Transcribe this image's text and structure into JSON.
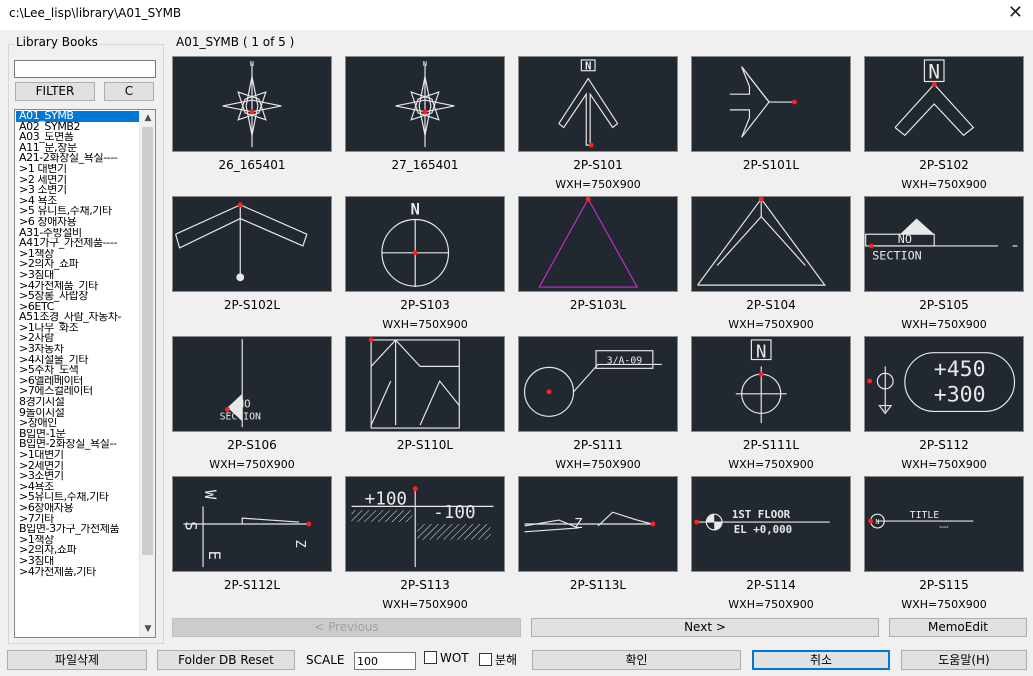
{
  "window": {
    "title": "c:\\Lee_lisp\\library\\A01_SYMB",
    "close_icon": "close-icon"
  },
  "sidebar": {
    "group_label": "Library Books",
    "filter_value": "",
    "filter_button": "FILTER",
    "clear_button": "C",
    "items": [
      "A01_SYMB",
      "A02_SYMB2",
      "A03_도면폼",
      "A11_문,창문",
      "A21-2화장실_욕실----",
      ">1 대변기",
      ">2 세면기",
      ">3 소변기",
      ">4 욕조",
      ">5 유니트,수채,기타",
      ">6 장애자용",
      "A31-주방설비",
      "A41가구_가전제품----",
      ">1책상",
      ">2의자_쇼파",
      ">3침대",
      ">4가전제품_기타",
      ">5장롱_사랍장",
      ">6ETC",
      "A51조경_사람_자동차-",
      ">1나무_화조",
      ">2사람",
      ">3자동차",
      ">4시설물_기타",
      ">5주차_도색",
      ">6엘레베이터",
      ">7에스컬레이터",
      "8경기시설",
      "9놀이시설",
      ">장애인",
      "B입면-1문",
      "B입면-2화장실_욕실--",
      ">1대변기",
      ">2세면기",
      ">3소변기",
      ">4욕조",
      ">5유니트,수채,기타",
      ">6장애자용",
      ">7기타",
      "B입면-3가구_가전제품",
      ">1책상",
      ">2의자,쇼파",
      ">3침대",
      ">4가전제품,기타"
    ]
  },
  "pager": {
    "label": "A01_SYMB ( 1 of 5 )"
  },
  "tiles": [
    {
      "name": "26_165401",
      "size": ""
    },
    {
      "name": "27_165401",
      "size": ""
    },
    {
      "name": "2P-S101",
      "size": "WXH=750X900"
    },
    {
      "name": "2P-S101L",
      "size": ""
    },
    {
      "name": "2P-S102",
      "size": "WXH=750X900"
    },
    {
      "name": "2P-S102L",
      "size": ""
    },
    {
      "name": "2P-S103",
      "size": "WXH=750X900"
    },
    {
      "name": "2P-S103L",
      "size": ""
    },
    {
      "name": "2P-S104",
      "size": "WXH=750X900"
    },
    {
      "name": "2P-S105",
      "size": "WXH=750X900"
    },
    {
      "name": "2P-S106",
      "size": "WXH=750X900"
    },
    {
      "name": "2P-S110L",
      "size": ""
    },
    {
      "name": "2P-S111",
      "size": "WXH=750X900"
    },
    {
      "name": "2P-S111L",
      "size": "WXH=750X900"
    },
    {
      "name": "2P-S112",
      "size": "WXH=750X900"
    },
    {
      "name": "2P-S112L",
      "size": ""
    },
    {
      "name": "2P-S113",
      "size": "WXH=750X900"
    },
    {
      "name": "2P-S113L",
      "size": ""
    },
    {
      "name": "2P-S114",
      "size": "WXH=750X900"
    },
    {
      "name": "2P-S115",
      "size": "WXH=750X900"
    }
  ],
  "symbol_text": {
    "n": "N",
    "no": "NO",
    "section": "SECTION",
    "ref": "3/A-09",
    "plus450": "+450",
    "plus300": "+300",
    "plus100": "+100",
    "minus100": "-100",
    "floor": "1ST FLOOR",
    "el": "EL +0,000",
    "title": "TITLE",
    "scale_small": "SCALE",
    "s": "S",
    "w": "W",
    "e": "E",
    "z": "Z"
  },
  "nav": {
    "previous": "< Previous",
    "next": "Next >",
    "memo": "MemoEdit"
  },
  "footer": {
    "delete_file": "파일삭제",
    "folder_reset": "Folder DB Reset",
    "scale_label": "SCALE",
    "scale_value": "100",
    "wot_label": "WOT",
    "split_label": "분해",
    "ok": "확인",
    "cancel": "취소",
    "help": "도움말(H)"
  },
  "colors": {
    "thumb_bg": "#212830",
    "selection": "#0078d7",
    "accent_point": "#ff2020",
    "magenta": "#c030c0"
  }
}
